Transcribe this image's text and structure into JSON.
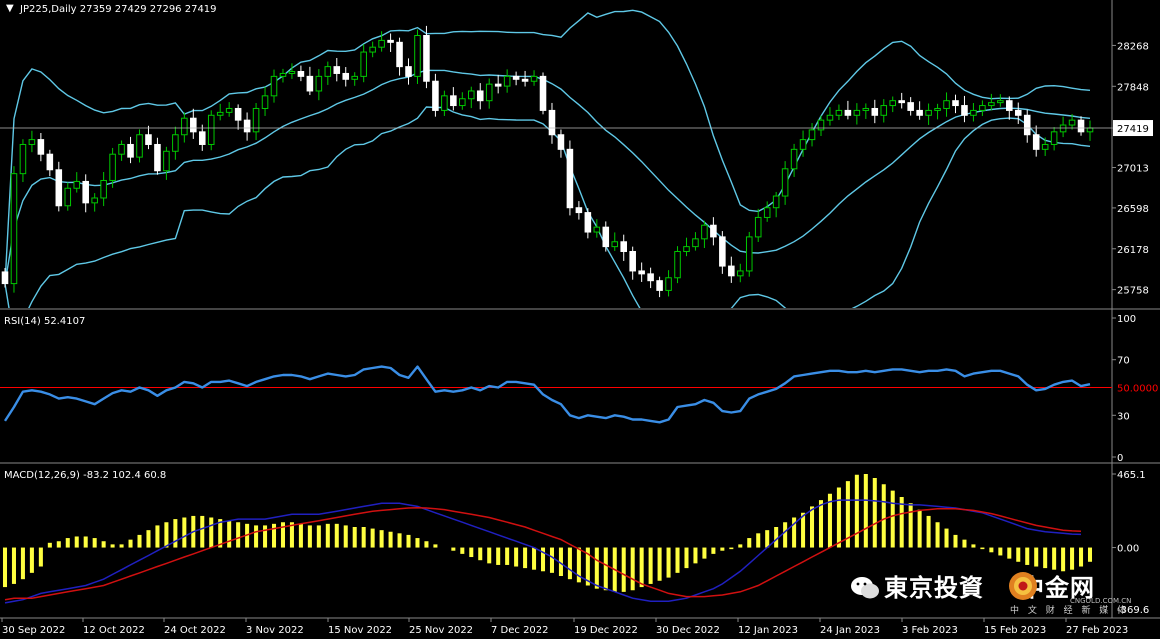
{
  "chart_data": [
    {
      "type": "candlestick",
      "title": "JP225,Daily",
      "ohlc_label": "27359 27429 27296 27419",
      "symbol_menu_icon": "triangle-down-icon",
      "current_price": "27419",
      "yticks": [
        "28268",
        "27848",
        "27419",
        "27013",
        "26598",
        "26178",
        "25758"
      ],
      "ylim": [
        25600,
        28550
      ],
      "up_color": "#00c800",
      "down_color": "#ffffff",
      "band_color": "#5fc8e6",
      "closes": [
        25820,
        26950,
        27250,
        27300,
        27150,
        26990,
        26620,
        26800,
        26870,
        26650,
        26700,
        26880,
        27150,
        27250,
        27120,
        27350,
        27250,
        26980,
        27180,
        27350,
        27520,
        27380,
        27250,
        27550,
        27580,
        27620,
        27500,
        27380,
        27620,
        27750,
        27950,
        27980,
        28000,
        27950,
        27800,
        27950,
        28050,
        27980,
        27920,
        27950,
        28200,
        28250,
        28320,
        28300,
        28050,
        27950,
        28370,
        27900,
        27600,
        27750,
        27650,
        27720,
        27800,
        27700,
        27870,
        27850,
        27950,
        27920,
        27900,
        27950,
        27600,
        27350,
        27200,
        26600,
        26550,
        26350,
        26400,
        26200,
        26250,
        26150,
        25950,
        25920,
        25850,
        25750,
        25880,
        26150,
        26200,
        26280,
        26420,
        26300,
        26000,
        25900,
        25950,
        26300,
        26500,
        26600,
        26720,
        27000,
        27200,
        27300,
        27400,
        27500,
        27550,
        27600,
        27550,
        27600,
        27620,
        27550,
        27650,
        27700,
        27680,
        27600,
        27550,
        27600,
        27620,
        27700,
        27650,
        27550,
        27600,
        27650,
        27680,
        27700,
        27600,
        27550,
        27350,
        27200,
        27250,
        27380,
        27450,
        27500,
        27380,
        27419
      ]
    },
    {
      "type": "line",
      "title": "RSI(14) 52.4107",
      "yticks": [
        "100",
        "70",
        "30",
        "0"
      ],
      "ylim": [
        0,
        100
      ],
      "level": 50,
      "level_label": "50.0000",
      "line_color": "#3a8ee6",
      "level_color": "#ff0000",
      "values": [
        26,
        36,
        47,
        48,
        47,
        45,
        42,
        43,
        42,
        40,
        38,
        42,
        46,
        48,
        47,
        50,
        48,
        44,
        48,
        50,
        54,
        53,
        50,
        54,
        54,
        55,
        53,
        51,
        54,
        56,
        58,
        59,
        59,
        58,
        56,
        58,
        60,
        59,
        58,
        59,
        63,
        64,
        65,
        64,
        59,
        57,
        65,
        56,
        47,
        48,
        47,
        48,
        50,
        48,
        51,
        50,
        54,
        54,
        53,
        52,
        45,
        41,
        38,
        30,
        28,
        30,
        29,
        28,
        30,
        29,
        27,
        27,
        26,
        25,
        27,
        36,
        37,
        38,
        41,
        39,
        33,
        32,
        33,
        42,
        45,
        47,
        49,
        53,
        58,
        59,
        60,
        61,
        62,
        62,
        61,
        61,
        62,
        61,
        62,
        63,
        63,
        62,
        61,
        62,
        62,
        63,
        62,
        58,
        60,
        61,
        62,
        62,
        60,
        58,
        52,
        48,
        49,
        52,
        54,
        55,
        51,
        52.41
      ]
    },
    {
      "type": "bar",
      "title": "MACD(12,26,9) -83.2 102.4 60.8",
      "yticks": [
        "465.1",
        "0.00"
      ],
      "bottom_label": "-369.6",
      "ylim": [
        -369.6,
        465.1
      ],
      "histogram_color": "#ffff40",
      "macd_line_color": "#2020c0",
      "signal_line_color": "#d01010",
      "histogram": [
        -250,
        -230,
        -200,
        -160,
        -120,
        30,
        40,
        60,
        70,
        70,
        60,
        40,
        20,
        20,
        50,
        80,
        110,
        140,
        160,
        180,
        190,
        200,
        200,
        190,
        180,
        170,
        160,
        150,
        140,
        140,
        150,
        160,
        160,
        150,
        140,
        140,
        150,
        150,
        140,
        130,
        130,
        120,
        110,
        100,
        90,
        80,
        60,
        40,
        20,
        0,
        -20,
        -40,
        -60,
        -80,
        -100,
        -110,
        -110,
        -120,
        -130,
        -140,
        -150,
        -160,
        -180,
        -200,
        -220,
        -240,
        -260,
        -270,
        -280,
        -280,
        -270,
        -250,
        -230,
        -210,
        -190,
        -160,
        -130,
        -100,
        -70,
        -40,
        -20,
        -10,
        20,
        60,
        90,
        110,
        130,
        160,
        190,
        220,
        260,
        300,
        340,
        380,
        420,
        460,
        465,
        440,
        400,
        360,
        320,
        280,
        240,
        200,
        160,
        120,
        80,
        50,
        20,
        -10,
        -30,
        -50,
        -70,
        -90,
        -110,
        -120,
        -130,
        -140,
        -150,
        -140,
        -120,
        -90
      ],
      "macd": [
        -350,
        -340,
        -330,
        -310,
        -290,
        -280,
        -270,
        -260,
        -250,
        -240,
        -220,
        -200,
        -170,
        -140,
        -110,
        -80,
        -50,
        -20,
        10,
        40,
        70,
        100,
        120,
        140,
        160,
        170,
        180,
        180,
        180,
        180,
        190,
        200,
        210,
        210,
        210,
        210,
        220,
        230,
        240,
        250,
        260,
        270,
        280,
        280,
        280,
        270,
        260,
        240,
        220,
        200,
        180,
        160,
        140,
        120,
        100,
        80,
        60,
        40,
        20,
        0,
        -30,
        -60,
        -100,
        -140,
        -180,
        -210,
        -240,
        -260,
        -280,
        -300,
        -320,
        -330,
        -340,
        -340,
        -340,
        -330,
        -320,
        -300,
        -280,
        -260,
        -230,
        -190,
        -150,
        -100,
        -50,
        0,
        50,
        100,
        150,
        200,
        240,
        270,
        290,
        300,
        300,
        300,
        300,
        295,
        290,
        280,
        275,
        270,
        270,
        265,
        260,
        255,
        250,
        240,
        230,
        220,
        200,
        180,
        160,
        140,
        120,
        110,
        100,
        95,
        90,
        85,
        83,
        -83.2
      ],
      "signal": [
        -330,
        -320,
        -320,
        -320,
        -310,
        -300,
        -290,
        -280,
        -270,
        -260,
        -250,
        -240,
        -220,
        -200,
        -180,
        -160,
        -140,
        -120,
        -100,
        -80,
        -60,
        -40,
        -20,
        0,
        20,
        40,
        60,
        80,
        100,
        110,
        120,
        130,
        140,
        150,
        160,
        170,
        180,
        190,
        200,
        210,
        220,
        230,
        235,
        240,
        245,
        250,
        252,
        250,
        245,
        240,
        230,
        220,
        210,
        200,
        190,
        175,
        160,
        145,
        130,
        110,
        90,
        70,
        50,
        20,
        -10,
        -40,
        -80,
        -110,
        -140,
        -170,
        -200,
        -230,
        -250,
        -270,
        -290,
        -300,
        -310,
        -310,
        -310,
        -305,
        -300,
        -290,
        -280,
        -260,
        -240,
        -210,
        -180,
        -150,
        -120,
        -90,
        -60,
        -30,
        0,
        30,
        60,
        90,
        120,
        150,
        180,
        200,
        215,
        225,
        235,
        240,
        245,
        245,
        245,
        240,
        235,
        225,
        215,
        200,
        185,
        170,
        155,
        140,
        130,
        120,
        110,
        105,
        103,
        102.4
      ]
    }
  ],
  "x_axis_labels": [
    "30 Sep 2022",
    "12 Oct 2022",
    "24 Oct 2022",
    "3 Nov 2022",
    "15 Nov 2022",
    "25 Nov 2022",
    "7 Dec 2022",
    "19 Dec 2022",
    "30 Dec 2022",
    "12 Jan 2023",
    "24 Jan 2023",
    "3 Feb 2023",
    "15 Feb 2023",
    "27 Feb 2023"
  ],
  "watermark": {
    "text": "東京投資",
    "text2": "中金网",
    "sub": "中 文 财 经 新 媒 体",
    "url": "CNGOLD.COM.CN",
    "logo_icon": "gold-coin-logo-icon",
    "chat_icon": "wechat-icon"
  }
}
